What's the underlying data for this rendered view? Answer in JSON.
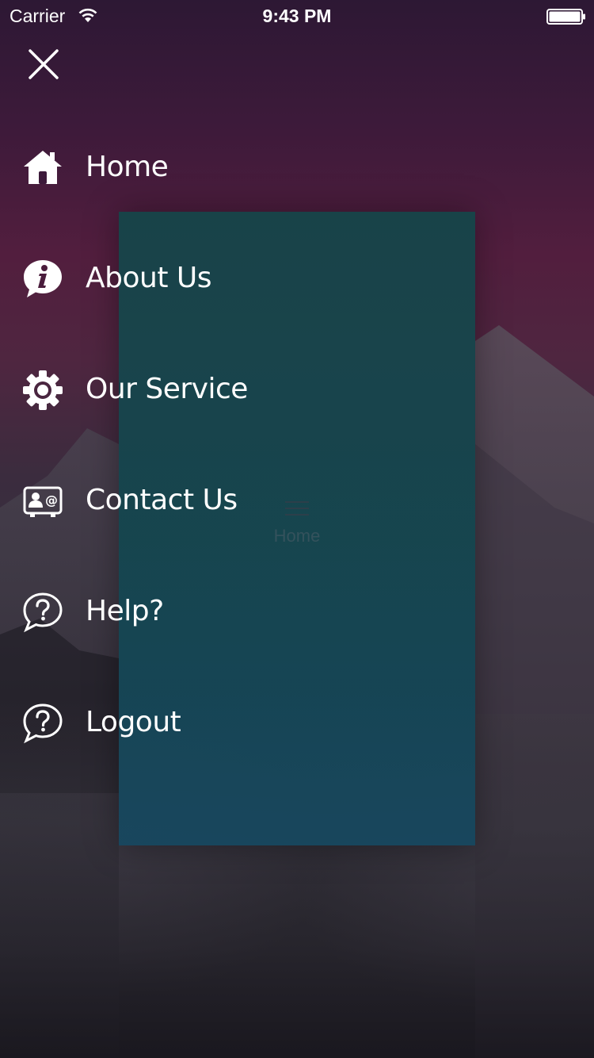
{
  "status_bar": {
    "carrier": "Carrier",
    "time": "9:43 PM",
    "wifi_icon": "wifi-icon",
    "battery_icon": "battery-full-icon"
  },
  "close_icon": "close-icon",
  "menu": {
    "items": [
      {
        "label": "Home",
        "icon": "home-icon"
      },
      {
        "label": "About Us",
        "icon": "info-icon"
      },
      {
        "label": "Our Service",
        "icon": "gear-icon"
      },
      {
        "label": "Contact Us",
        "icon": "contact-card-icon"
      },
      {
        "label": "Help?",
        "icon": "help-bubble-icon"
      },
      {
        "label": "Logout",
        "icon": "logout-icon"
      }
    ]
  },
  "content_card": {
    "title": "Home",
    "menu_icon": "hamburger-icon",
    "accent_color": "#11484a"
  },
  "colors": {
    "background_top": "#2d1834",
    "background_mid": "#521e3e",
    "background_bottom": "#1d1b22",
    "menu_text": "#ffffff"
  }
}
